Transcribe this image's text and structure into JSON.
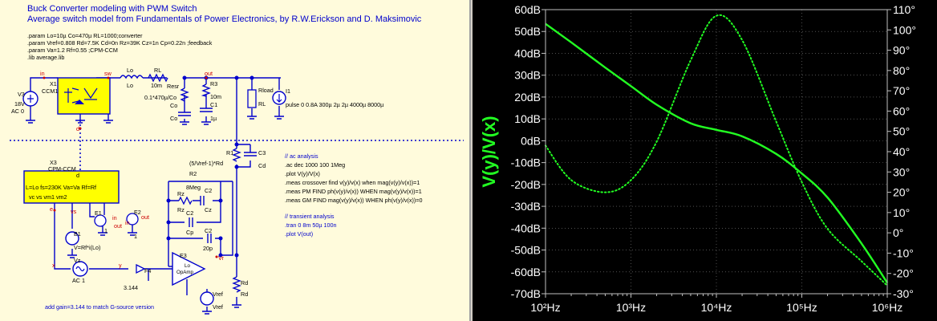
{
  "schematic": {
    "title1": "Buck Converter modeling with PWM Switch",
    "title2": "Average switch model from Fundamentals of Power Electronics, by R.W.Erickson and D. Maksimovic",
    "params": [
      ".param Lo=10µ Co=470µ RL=1000;converter",
      ".param Vref=0.808 Rd=7.5K Cd=0n Rz=39K Cz=1n Cp=0.22n ;feedback",
      ".param Va=1.2 Rf=0.55 ;CPM-CCM",
      ".lib average.lib"
    ],
    "ac_comments": [
      "// ac analysis",
      ".ac dec 1000 100 1Meg",
      ".plot V(y)/V(x)",
      ".meas crossover find v(y)/v(x) when mag(v(y)/v(x))=1",
      ".meas PM FIND ph(v(y)/v(x)) WHEN mag(v(y)/v(x))=1",
      ".meas GM FIND mag(v(y)/v(x)) WHEN ph(v(y)/v(x))=0"
    ],
    "tran_comments": [
      "// transient analysis",
      ".tran 0 8m 50µ 100n",
      ".plot V(out)"
    ],
    "gain_note": "add gain=3.144 to match G-source version",
    "labels": {
      "V3": "V3",
      "V3_val1": "18V",
      "V3_val2": "AC 0",
      "X1": "X1",
      "X1_model": "CCM1",
      "in": "in",
      "sw": "sw",
      "d": "d",
      "Lo": "Lo",
      "Lo_val": "Lo",
      "RL_top": "RL",
      "RL_val": "10m",
      "Resr": "Resr",
      "Resr_val": "0.1*470µ/Co",
      "R3": "R3",
      "R3_val": "10m",
      "Co": "Co",
      "Co_val": "Co",
      "C1": "C1",
      "C1_val": "1µ",
      "out": "out",
      "Rload": "Rload",
      "Rload_val": "RL",
      "I1": "I1",
      "I1_val": "pulse 0 0.8A 300µ 2µ 2µ 4000µ 8000µ",
      "X3": "X3",
      "X3_model": "CPM-CCM",
      "X3_d": "d",
      "X3_params": "L=Lo fs=230K Va=Va Rf=Rf",
      "X3_pins": "vc     vs     vm1  vm2",
      "R1": "R1",
      "R1_val": "(5/Vref-1)*Rd",
      "C3": "C3",
      "C3_val": "Cd",
      "R2": "R2",
      "R2_val": "8Meg",
      "Rz1": "Rz",
      "Rz2": "Rz",
      "Cz1": "C2",
      "Cz2": "Cz",
      "Cp1": "C2",
      "Cp2": "Cp",
      "Cp3": "Cp",
      "C2": "C2",
      "C2_val": "20p",
      "E1": "E1",
      "E2": "E2",
      "one1": "1",
      "one2": "1",
      "in_pin": "in",
      "out_pin": "out",
      "in_pin2": "in",
      "out_pin2": "out",
      "e": "e",
      "vs": "vs",
      "B1": "B1",
      "B1_val": "V=Rf*i(Lo)",
      "Vz": "Vz",
      "Vz_val": "AC 1",
      "x": "x",
      "y": "y",
      "F4": "F4",
      "F4_val": "3.144",
      "E3": "E3",
      "E3_model": "OpAmp",
      "Lo_e3": "Lo",
      "Vr": "Vr",
      "Vref": "Vref",
      "Vref_val": "Vref",
      "Rd": "Rd",
      "Rd_val": "Rd"
    }
  },
  "plot": {
    "ylabel": "V(y)/V(x)",
    "left_ticks": [
      "60dB",
      "50dB",
      "40dB",
      "30dB",
      "20dB",
      "10dB",
      "0dB",
      "-10dB",
      "-20dB",
      "-30dB",
      "-40dB",
      "-50dB",
      "-60dB",
      "-70dB"
    ],
    "right_ticks": [
      "110°",
      "100°",
      "90°",
      "80°",
      "70°",
      "60°",
      "50°",
      "40°",
      "30°",
      "20°",
      "10°",
      "0°",
      "-10°",
      "-20°",
      "-30°"
    ],
    "x_ticks": [
      "10²Hz",
      "10³Hz",
      "10⁴Hz",
      "10⁵Hz",
      "10⁶Hz"
    ],
    "colors": {
      "trace": "#22ff22",
      "grid": "#808080",
      "axis_text": "#ffffff"
    }
  },
  "chart_data": {
    "type": "line",
    "title": "",
    "xlabel": "",
    "ylabel": "V(y)/V(x)",
    "x_scale": "log",
    "xlim": [
      100,
      1000000
    ],
    "ylim_left": [
      -70,
      60
    ],
    "ylim_right": [
      -30,
      110
    ],
    "series": [
      {
        "style": "solid",
        "axis": "left",
        "x": [
          100,
          200,
          500,
          1000,
          2000,
          5000,
          10000,
          20000,
          50000,
          100000,
          200000,
          500000,
          1000000
        ],
        "y": [
          53.5,
          45,
          33.5,
          25,
          16.5,
          8,
          5,
          2,
          -6,
          -15,
          -26,
          -47,
          -65
        ]
      },
      {
        "style": "dotted",
        "axis": "right",
        "x": [
          100,
          200,
          500,
          1000,
          2000,
          5000,
          10000,
          20000,
          50000,
          100000,
          200000,
          500000,
          1000000
        ],
        "y": [
          43,
          26,
          20,
          26,
          45,
          85,
          107,
          95,
          55,
          25,
          2,
          -14,
          -26
        ]
      }
    ]
  }
}
